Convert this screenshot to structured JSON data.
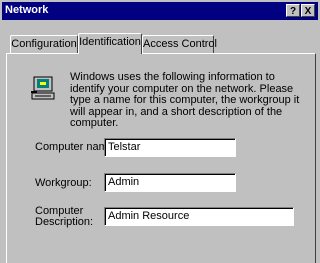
{
  "window": {
    "title": "Network"
  },
  "titlebar_buttons": {
    "help": "?",
    "close": "X"
  },
  "tabs": [
    {
      "label": "Configuration",
      "active": false
    },
    {
      "label": "Identification",
      "active": true
    },
    {
      "label": "Access Control",
      "active": false
    }
  ],
  "identification": {
    "icon": "network-computer-icon",
    "description": "Windows uses the following information to identify your computer on the network.  Please type a name for this computer, the workgroup it will appear in, and a short description of the computer.",
    "fields": {
      "computer_name": {
        "label": "Computer name:",
        "value": "Telstar"
      },
      "workgroup": {
        "label": "Workgroup:",
        "value": "Admin"
      },
      "description": {
        "label_line1": "Computer",
        "label_line2": "Description:",
        "value": "Admin Resource"
      }
    }
  }
}
